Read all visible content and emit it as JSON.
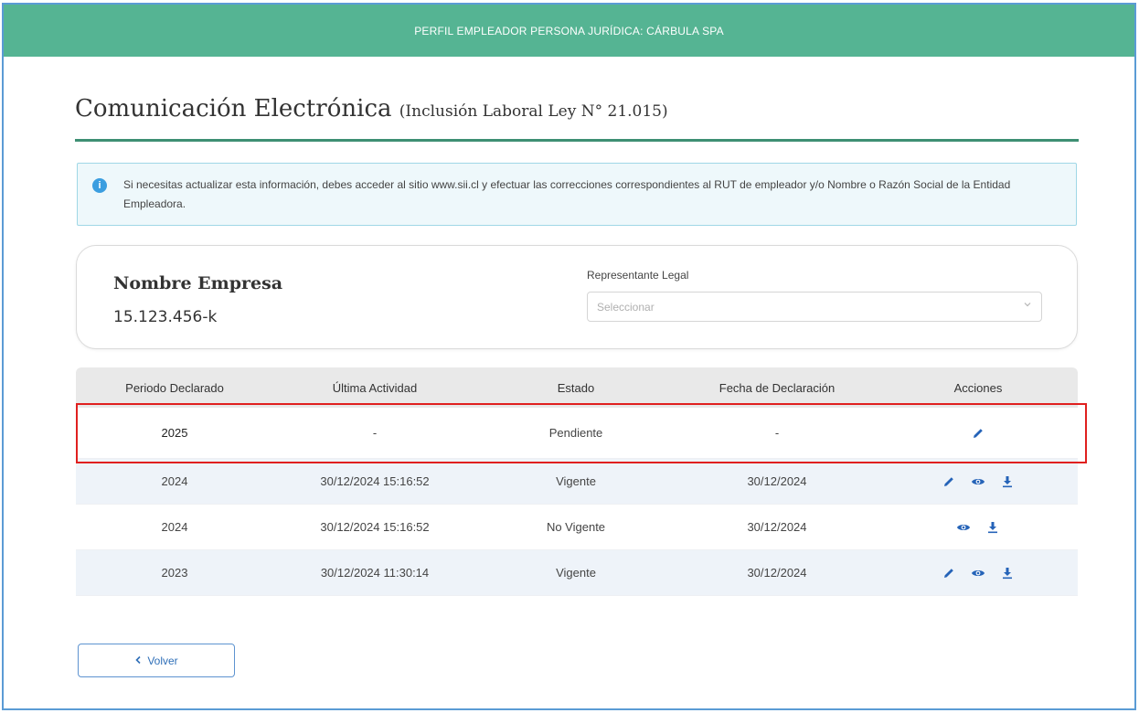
{
  "header": {
    "profile_label": "PERFIL EMPLEADOR PERSONA JURÍDICA: CÁRBULA SPA"
  },
  "page": {
    "title": "Comunicación Electrónica",
    "subtitle": "(Inclusión Laboral Ley N° 21.015)"
  },
  "alert": {
    "icon": "info-icon",
    "text": "Si necesitas actualizar esta información, debes acceder al sitio www.sii.cl y efectuar las correcciones correspondientes al RUT de empleador y/o Nombre o Razón Social de la Entidad Empleadora."
  },
  "company": {
    "name": "Nombre Empresa",
    "rut": "15.123.456-k",
    "rep_label": "Representante Legal",
    "rep_placeholder": "Seleccionar"
  },
  "table": {
    "headers": [
      "Periodo Declarado",
      "Última Actividad",
      "Estado",
      "Fecha de Declaración",
      "Acciones"
    ],
    "rows": [
      {
        "periodo": "2025",
        "actividad": "-",
        "estado": "Pendiente",
        "fecha": "-",
        "actions": [
          "edit-icon"
        ]
      },
      {
        "periodo": "2024",
        "actividad": "30/12/2024 15:16:52",
        "estado": "Vigente",
        "fecha": "30/12/2024",
        "actions": [
          "edit-icon",
          "view-icon",
          "download-icon"
        ]
      },
      {
        "periodo": "2024",
        "actividad": "30/12/2024 15:16:52",
        "estado": "No Vigente",
        "fecha": "30/12/2024",
        "actions": [
          "view-icon",
          "download-icon"
        ]
      },
      {
        "periodo": "2023",
        "actividad": "30/12/2024 11:30:14",
        "estado": "Vigente",
        "fecha": "30/12/2024",
        "actions": [
          "edit-icon",
          "view-icon",
          "download-icon"
        ]
      }
    ]
  },
  "footer": {
    "back_label": "Volver"
  },
  "colors": {
    "header_bg": "#55b493",
    "accent_rule": "#3e8f73",
    "icon_blue": "#2563b8",
    "highlight": "#e0201f"
  }
}
